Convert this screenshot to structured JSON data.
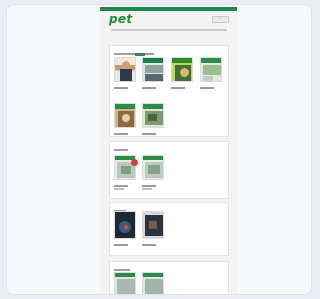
{
  "header": {
    "logo_text": "pet",
    "button_label": "≡"
  },
  "sections": [
    {
      "id": "latest",
      "title": "",
      "cards": [
        {
          "caption": ""
        },
        {
          "caption": ""
        },
        {
          "caption": ""
        },
        {
          "caption": ""
        },
        {
          "caption": ""
        },
        {
          "caption": ""
        }
      ]
    },
    {
      "id": "mid1",
      "title": "",
      "cards": [
        {
          "caption": ""
        },
        {
          "caption": ""
        }
      ]
    },
    {
      "id": "mid2",
      "title": "",
      "cards": [
        {
          "caption": ""
        },
        {
          "caption": ""
        }
      ]
    },
    {
      "id": "bottom",
      "title": "",
      "cards": [
        {
          "caption": ""
        },
        {
          "caption": ""
        }
      ]
    }
  ],
  "colors": {
    "brand": "#1f8a43",
    "badge": "#d93a3a"
  }
}
